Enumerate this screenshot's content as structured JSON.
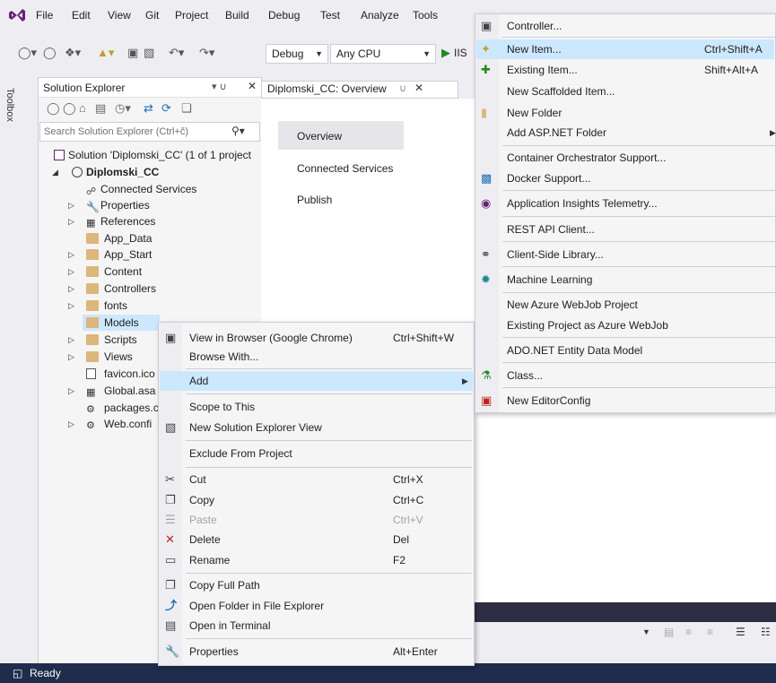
{
  "menu": [
    "File",
    "Edit",
    "View",
    "Git",
    "Project",
    "Build",
    "Debug",
    "Test",
    "Analyze",
    "Tools"
  ],
  "toolbar": {
    "config": "Debug",
    "platform": "Any CPU",
    "run_label": "IIS"
  },
  "toolbox_tab": "Toolbox",
  "solution_explorer": {
    "title": "Solution Explorer",
    "search_placeholder": "Search Solution Explorer (Ctrl+č)",
    "solution": "Solution 'Diplomski_CC' (1 of 1 project",
    "project": "Diplomski_CC",
    "items": [
      "Connected Services",
      "Properties",
      "References",
      "App_Data",
      "App_Start",
      "Content",
      "Controllers",
      "fonts",
      "Models",
      "Scripts",
      "Views",
      "favicon.ico",
      "Global.asa",
      "packages.c",
      "Web.confi"
    ]
  },
  "document": {
    "tab": "Diplomski_CC: Overview",
    "nav": [
      "Overview",
      "Connected Services",
      "Publish"
    ]
  },
  "context_menu": {
    "items": [
      {
        "label": "View in Browser (Google Chrome)",
        "shortcut": "Ctrl+Shift+W"
      },
      {
        "label": "Browse With...",
        "shortcut": ""
      },
      {
        "label": "Add",
        "shortcut": ""
      },
      {
        "label": "Scope to This",
        "shortcut": ""
      },
      {
        "label": "New Solution Explorer View",
        "shortcut": ""
      },
      {
        "label": "Exclude From Project",
        "shortcut": ""
      },
      {
        "label": "Cut",
        "shortcut": "Ctrl+X"
      },
      {
        "label": "Copy",
        "shortcut": "Ctrl+C"
      },
      {
        "label": "Paste",
        "shortcut": "Ctrl+V"
      },
      {
        "label": "Delete",
        "shortcut": "Del"
      },
      {
        "label": "Rename",
        "shortcut": "F2"
      },
      {
        "label": "Copy Full Path",
        "shortcut": ""
      },
      {
        "label": "Open Folder in File Explorer",
        "shortcut": ""
      },
      {
        "label": "Open in Terminal",
        "shortcut": ""
      },
      {
        "label": "Properties",
        "shortcut": "Alt+Enter"
      }
    ]
  },
  "add_submenu": {
    "items": [
      {
        "label": "Controller...",
        "shortcut": ""
      },
      {
        "label": "New Item...",
        "shortcut": "Ctrl+Shift+A"
      },
      {
        "label": "Existing Item...",
        "shortcut": "Shift+Alt+A"
      },
      {
        "label": "New Scaffolded Item...",
        "shortcut": ""
      },
      {
        "label": "New Folder",
        "shortcut": ""
      },
      {
        "label": "Add ASP.NET Folder",
        "shortcut": ""
      },
      {
        "label": "Container Orchestrator Support...",
        "shortcut": ""
      },
      {
        "label": "Docker Support...",
        "shortcut": ""
      },
      {
        "label": "Application Insights Telemetry...",
        "shortcut": ""
      },
      {
        "label": "REST API Client...",
        "shortcut": ""
      },
      {
        "label": "Client-Side Library...",
        "shortcut": ""
      },
      {
        "label": "Machine Learning",
        "shortcut": ""
      },
      {
        "label": "New Azure WebJob Project",
        "shortcut": ""
      },
      {
        "label": "Existing Project as Azure WebJob",
        "shortcut": ""
      },
      {
        "label": "ADO.NET Entity Data Model",
        "shortcut": ""
      },
      {
        "label": "Class...",
        "shortcut": ""
      },
      {
        "label": "New EditorConfig",
        "shortcut": ""
      }
    ]
  },
  "status": {
    "text": "Ready"
  },
  "colors": {
    "accent": "#68217a",
    "highlight": "#cce8ff",
    "status_bar": "#1f2d4c",
    "folder": "#dcb67a"
  },
  "icons": {
    "menu_vs": "visual-studio-logo",
    "ctx": [
      "browser-icon",
      "",
      "",
      "",
      "new-view-icon",
      "",
      "scissors-icon",
      "copy-icon",
      "paste-icon",
      "delete-x-icon",
      "rename-icon",
      "copy-path-icon",
      "open-folder-arrow-icon",
      "terminal-icon",
      "wrench-icon"
    ]
  }
}
